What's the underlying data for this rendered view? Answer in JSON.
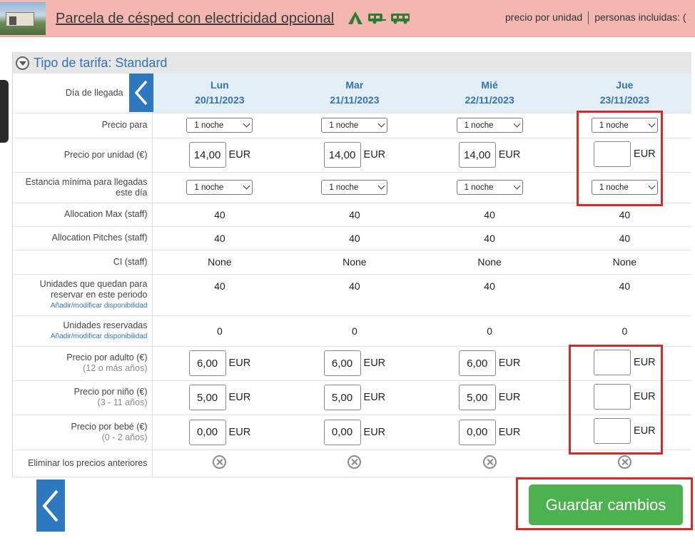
{
  "header": {
    "title": "Parcela de césped con electricidad opcional",
    "price_per_unit": "precio por unidad",
    "persons_included": "personas incluidas: (",
    "icons": [
      "tent-icon",
      "caravan-icon",
      "motorhome-icon"
    ]
  },
  "panel": {
    "title": "Tipo de tarifa: Standard"
  },
  "labels": {
    "arrival_day": "Día de llegada",
    "price_for": "Precio para",
    "price_per_unit": "Precio por unidad (€)",
    "min_stay": "Estancia mínima para llegadas este día",
    "allocation_max": "Allocation Max (staff)",
    "allocation_pitches": "Allocation Pitches (staff)",
    "ci": "CI (staff)",
    "units_left": "Unidades que quedan para reservar en este periodo",
    "units_booked": "Unidades reservadas",
    "modify_availability": "Añadir/modificar disponibilidad",
    "adult_price": "Precio por adulto (€)",
    "adult_ages": "(12 o más años)",
    "child_price": "Precio por niño (€)",
    "child_ages": "(3 - 11 años)",
    "baby_price": "Precio por bebé (€)",
    "baby_ages": "(0 - 2 años)",
    "delete_previous": "Eliminar los precios anteriores"
  },
  "currency": "EUR",
  "days": [
    {
      "dow": "Lun",
      "date": "20/11/2023",
      "price_for": "1 noche",
      "unit_price": "14,00",
      "min_stay": "1 noche",
      "alloc_max": "40",
      "alloc_pitches": "40",
      "ci": "None",
      "units_left": "40",
      "units_booked": "0",
      "adult": "6,00",
      "child": "5,00",
      "baby": "0,00"
    },
    {
      "dow": "Mar",
      "date": "21/11/2023",
      "price_for": "1 noche",
      "unit_price": "14,00",
      "min_stay": "1 noche",
      "alloc_max": "40",
      "alloc_pitches": "40",
      "ci": "None",
      "units_left": "40",
      "units_booked": "0",
      "adult": "6,00",
      "child": "5,00",
      "baby": "0,00"
    },
    {
      "dow": "Mié",
      "date": "22/11/2023",
      "price_for": "1 noche",
      "unit_price": "14,00",
      "min_stay": "1 noche",
      "alloc_max": "40",
      "alloc_pitches": "40",
      "ci": "None",
      "units_left": "40",
      "units_booked": "0",
      "adult": "6,00",
      "child": "5,00",
      "baby": "0,00"
    },
    {
      "dow": "Jue",
      "date": "23/11/2023",
      "price_for": "1 noche",
      "unit_price": "",
      "min_stay": "1 noche",
      "alloc_max": "40",
      "alloc_pitches": "40",
      "ci": "None",
      "units_left": "40",
      "units_booked": "0",
      "adult": "",
      "child": "",
      "baby": ""
    }
  ],
  "save_button": "Guardar cambios",
  "colors": {
    "accent": "#2e78c0",
    "header_bg": "#f3b7b0",
    "save": "#4cb14f",
    "highlight": "#d12b2b"
  }
}
